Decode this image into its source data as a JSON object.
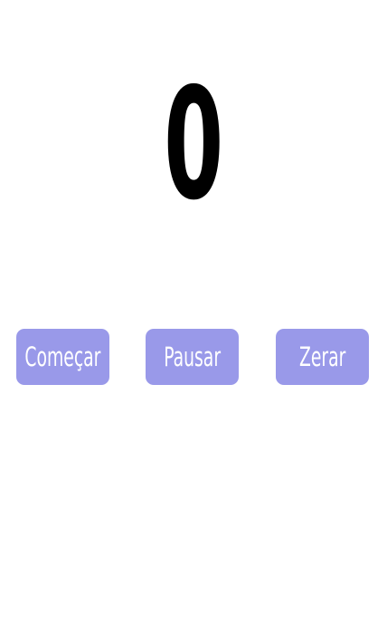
{
  "timer": {
    "value": "0"
  },
  "controls": {
    "start_label": "Começar",
    "pause_label": "Pausar",
    "reset_label": "Zerar"
  },
  "colors": {
    "background": "#ffffff",
    "timer_text": "#000000",
    "button_background": "#9999e9",
    "button_text": "#ffffff"
  }
}
